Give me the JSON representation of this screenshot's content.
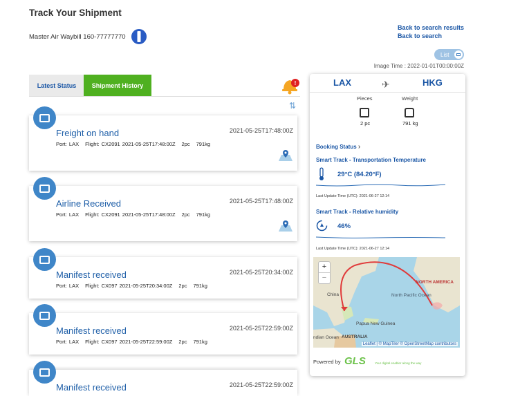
{
  "page": {
    "title": "Track Your Shipment",
    "awb_label": "Master Air Waybill 160-77777770",
    "links": [
      "Back to search results",
      "Back to search"
    ],
    "list_label": "List",
    "image_time": "Image Time : 2022-01-01T00:00:00Z"
  },
  "tabs": [
    {
      "label": "Latest Status"
    },
    {
      "label": "Shipment History"
    }
  ],
  "events": [
    {
      "title": "Freight on hand",
      "time": "2021-05-25T17:48:00Z",
      "port": "Port: LAX",
      "flight": "Flight: CX2091 2021-05-25T17:48:00Z",
      "pieces": "2pc",
      "weight": "791kg"
    },
    {
      "title": "Airline Received",
      "time": "2021-05-25T17:48:00Z",
      "port": "Port: LAX",
      "flight": "Flight: CX2091 2021-05-25T17:48:00Z",
      "pieces": "2pc",
      "weight": "791kg"
    },
    {
      "title": "Manifest received",
      "time": "2021-05-25T20:34:00Z",
      "port": "Port: LAX",
      "flight": "Flight: CX097 2021-05-25T20:34:00Z",
      "pieces": "2pc",
      "weight": "791kg"
    },
    {
      "title": "Manifest received",
      "time": "2021-05-25T22:59:00Z",
      "port": "Port: LAX",
      "flight": "Flight: CX097 2021-05-25T22:59:00Z",
      "pieces": "2pc",
      "weight": "791kg"
    },
    {
      "title": "Manifest received",
      "time": "2021-05-25T22:59:00Z"
    }
  ],
  "summary": {
    "origin": "LAX",
    "destination": "HKG",
    "pieces_label": "Pieces",
    "weight_label": "Weight",
    "pieces_value": "2 pc",
    "weight_value": "791 kg",
    "booking_status": "Booking Status",
    "temp_title": "Smart Track - Transportation Temperature",
    "temp_value": "29°C (84.20°F)",
    "temp_updated": "Last Update Time (UTC): 2021-06-27 12:14",
    "hum_title": "Smart Track - Relative humidity",
    "hum_value": "46%",
    "hum_updated": "Last Update Time (UTC): 2021-06-27 12:14"
  },
  "map": {
    "zoom_in": "+",
    "zoom_out": "−",
    "attribution": "Leaflet | © MapTiler © OpenStreetMap contributors",
    "labels": [
      "NORTH AMERICA",
      "North Pacific Ocean",
      "China",
      "Papua New Guinea",
      "AUSTRALIA",
      "ndian Ocean"
    ]
  },
  "footer": {
    "powered_by": "Powered by",
    "brand": "GLS",
    "tagline": "Your digital enabler along the way"
  },
  "colors": {
    "accent": "#1a56a5",
    "tab_active": "#4fb020",
    "badge": "#3f86c8"
  }
}
